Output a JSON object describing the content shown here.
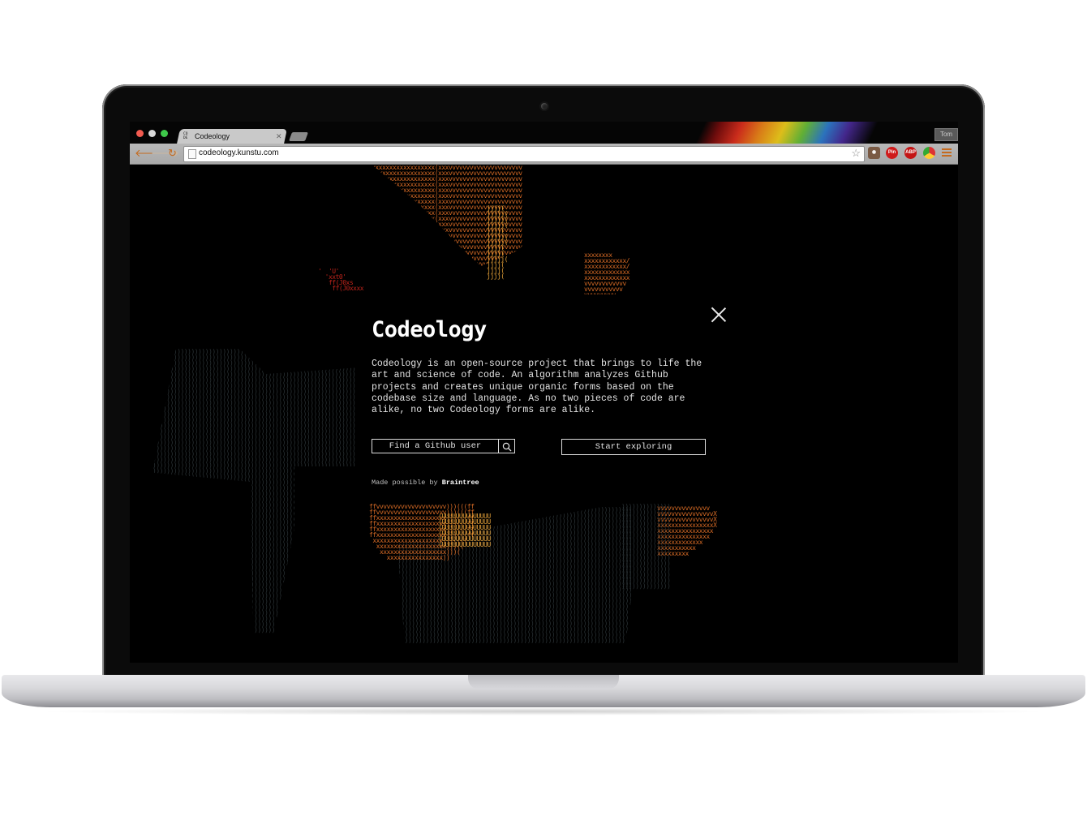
{
  "browser": {
    "tab_title": "Codeology",
    "favicon_text": [
      "CO",
      "DE"
    ],
    "url": "codeology.kunstu.com",
    "profile_name": "Tom",
    "extensions": [
      "camera-icon",
      "Pin",
      "ABP",
      "chrome-icon"
    ],
    "colors": {
      "tab_bg": "#c9c9c9",
      "toolbar_bg": "#b0b0b0",
      "accent": "#c56a1e"
    }
  },
  "modal": {
    "title": "Codeology",
    "description": "Codeology is an open-source project that brings to life the art and science of code. An algorithm analyzes Github projects and creates unique organic forms based on the codebase size and language. As no two pieces of code are alike, no two Codeology forms are alike.",
    "find_user_label": "Find a Github user",
    "explore_label": "Start exploring",
    "credit_prefix": "Made possible by",
    "credit_brand": "Braintree"
  },
  "page": {
    "background": "#000000",
    "art_colors": [
      "#d66a25",
      "#e9a43a",
      "#2b3336",
      "#c0241b"
    ]
  }
}
